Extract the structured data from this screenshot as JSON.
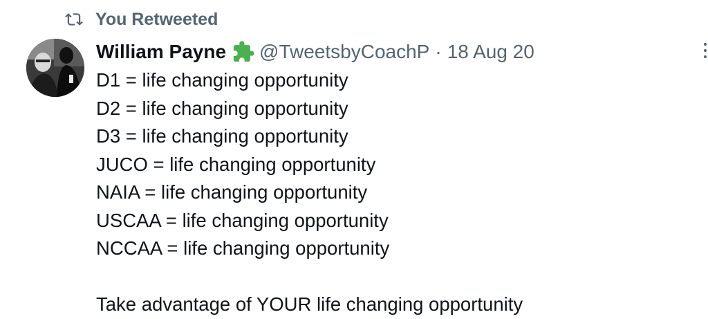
{
  "social_context": {
    "text": "You Retweeted",
    "icon": "retweet-icon"
  },
  "author": {
    "display_name": "William Payne",
    "badge_icon": "puzzle-piece-icon",
    "badge_color": "#4caf50",
    "handle": "@TweetsbyCoachP",
    "separator": "·",
    "timestamp": "18 Aug 20"
  },
  "tweet": {
    "lines": [
      "D1 = life changing opportunity",
      "D2 = life changing opportunity",
      "D3 = life changing opportunity",
      "JUCO = life changing opportunity",
      "NAIA = life changing opportunity",
      "USCAA = life changing opportunity",
      "NCCAA = life changing opportunity",
      "",
      "Take advantage of YOUR life changing opportunity"
    ]
  },
  "colors": {
    "text_primary": "#0f1419",
    "text_secondary": "#536471"
  }
}
